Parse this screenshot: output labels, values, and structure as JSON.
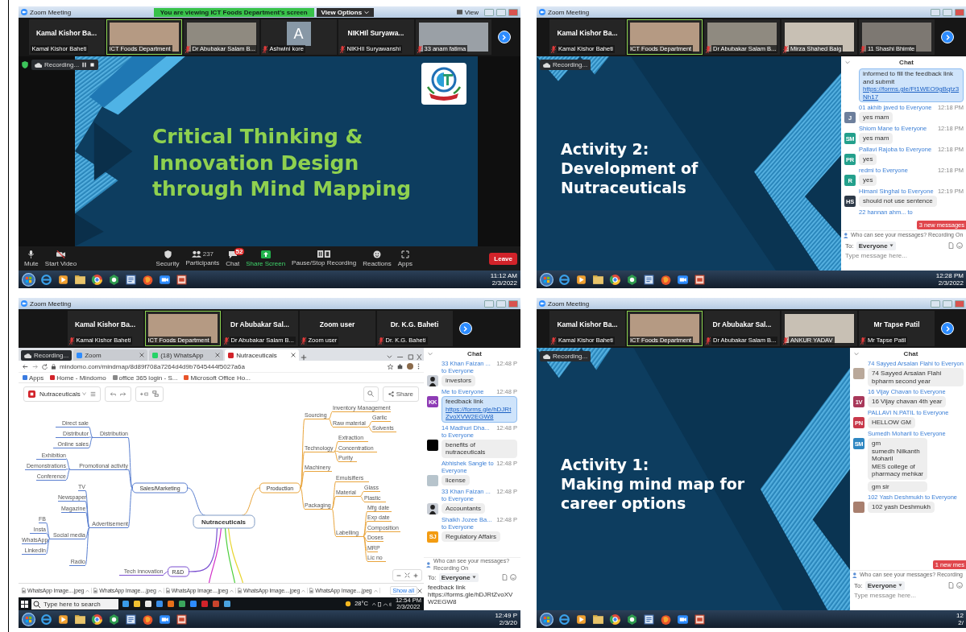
{
  "panels": [
    {
      "kind": "slide-share",
      "title": "Zoom Meeting",
      "banner": "You are viewing ICT Foods Department's screen",
      "view_options": "View Options",
      "view_label": "View",
      "participants": [
        {
          "kind": "name",
          "name": "Kamal Kishor Ba...",
          "label": "Kamal Kishor Baheti",
          "muted": false,
          "speaking": false
        },
        {
          "kind": "video",
          "label": "ICT Foods Department",
          "muted": false,
          "speaking": true
        },
        {
          "kind": "video",
          "label": "Dr Abubakar Salam B...",
          "muted": true,
          "speaking": false
        },
        {
          "kind": "letter",
          "letter": "A",
          "label": "Ashwini kore",
          "muted": true,
          "speaking": false
        },
        {
          "kind": "name",
          "name": "NIKHIl Suryawa...",
          "label": "NIKHIl Suryawanshi",
          "muted": true,
          "speaking": false
        },
        {
          "kind": "video",
          "label": "33 anam fatima",
          "muted": true,
          "speaking": false
        }
      ],
      "recording": "Recording...",
      "slide": {
        "kind": "green-title",
        "logo": true,
        "lines": [
          "Critical Thinking &",
          "Innovation Design",
          "through Mind Mapping"
        ]
      },
      "toolbar": [
        {
          "kind": "mic",
          "label": "Mute"
        },
        {
          "kind": "video",
          "label": "Start Video"
        },
        {
          "kind": "shield",
          "label": "Security"
        },
        {
          "kind": "people",
          "label": "Participants",
          "count": "237"
        },
        {
          "kind": "chat",
          "label": "Chat",
          "badge": "52"
        },
        {
          "kind": "share",
          "label": "Share Screen"
        },
        {
          "kind": "record",
          "label": "Pause/Stop Recording"
        },
        {
          "kind": "reactions",
          "label": "Reactions"
        },
        {
          "kind": "apps",
          "label": "Apps"
        }
      ],
      "leave": "Leave",
      "clock": {
        "time": "11:12 AM",
        "date": "2/3/2022"
      }
    },
    {
      "kind": "slide-chat",
      "title": "Zoom Meeting",
      "participants": [
        {
          "kind": "name",
          "name": "Kamal Kishor Ba...",
          "label": "Kamal Kishor Baheti",
          "muted": true,
          "speaking": false
        },
        {
          "kind": "video",
          "label": "ICT Foods Department",
          "muted": false,
          "speaking": true
        },
        {
          "kind": "video",
          "label": "Dr Abubakar Salam B...",
          "muted": true,
          "speaking": false
        },
        {
          "kind": "video",
          "label": "Mirza Shahed Baig",
          "muted": true,
          "speaking": false
        },
        {
          "kind": "video",
          "label": "11 Shashi Bhimte",
          "muted": true,
          "speaking": false
        }
      ],
      "recording": "Recording...",
      "slide": {
        "kind": "white-title",
        "lines": [
          "Activity 2:",
          "Development of",
          "Nutraceuticals"
        ]
      },
      "chat": {
        "title": "Chat",
        "messages": [
          {
            "own": true,
            "bubbles": [
              {
                "text": "informed to fill the feedback link and submit",
                "link": "https://forms.gle/Ft1WEO9gBqtz3Nh17"
              }
            ]
          },
          {
            "own": false,
            "header": "01 akhib javed to Everyone",
            "time": "12:18 PM",
            "avatar": {
              "kind": "initials",
              "text": "J",
              "color": "#6d7f9c"
            },
            "bubbles": [
              {
                "text": "yes mam"
              }
            ]
          },
          {
            "own": false,
            "header": "Shiom Mane to Everyone",
            "time": "12:18 PM",
            "avatar": {
              "kind": "initials",
              "text": "SM",
              "color": "#23a08c"
            },
            "bubbles": [
              {
                "text": "yes mam"
              }
            ]
          },
          {
            "own": false,
            "header": "Pallavi Rajoba to Everyone",
            "time": "12:18 PM",
            "avatar": {
              "kind": "initials",
              "text": "PR",
              "color": "#23a08c"
            },
            "bubbles": [
              {
                "text": "yes"
              }
            ]
          },
          {
            "own": false,
            "header": "redmi to Everyone",
            "time": "12:18 PM",
            "avatar": {
              "kind": "initials",
              "text": "R",
              "color": "#23a08c"
            },
            "bubbles": [
              {
                "text": "yes"
              }
            ]
          },
          {
            "own": false,
            "header": "Himani Singhal to Everyone",
            "time": "12:19 PM",
            "avatar": {
              "kind": "initials",
              "text": "HS",
              "color": "#2e3a48"
            },
            "bubbles": [
              {
                "text": "should not use sentence"
              }
            ]
          },
          {
            "header": "22 hannan ahm... to"
          }
        ],
        "new_messages": "3 new messages",
        "privacy": "Who can see your messages? Recording On",
        "to_label": "To:",
        "recipient": "Everyone",
        "placeholder": "Type message here..."
      },
      "clock": {
        "time": "12:28 PM",
        "date": "2/3/2022"
      }
    },
    {
      "kind": "browser-chat",
      "title": "Zoom Meeting",
      "participants": [
        {
          "kind": "name",
          "name": "Kamal Kishor Ba...",
          "label": "Kamal Kishor Baheti",
          "muted": true,
          "speaking": false
        },
        {
          "kind": "video",
          "label": "ICT Foods Department",
          "muted": false,
          "speaking": true
        },
        {
          "kind": "name",
          "name": "Dr Abubakar Sal...",
          "label": "Dr Abubakar Salam B...",
          "muted": true,
          "speaking": false
        },
        {
          "kind": "name",
          "name": "Zoom user",
          "label": "Zoom user",
          "muted": true,
          "speaking": false
        },
        {
          "kind": "name",
          "name": "Dr. K.G. Baheti",
          "label": "Dr. K.G. Baheti",
          "muted": true,
          "speaking": false
        }
      ],
      "recording": "Recording...",
      "browser": {
        "tabs": [
          {
            "title": "Zoom",
            "selected": false
          },
          {
            "title": "(18) WhatsApp",
            "selected": false
          },
          {
            "title": "Nutraceuticals",
            "selected": true
          }
        ],
        "url": "mindomo.com/mindmap/8d89f708a7264d4d9b7645444f5027a6a",
        "bookmarks": [
          "Apps",
          "Home - Mindomo",
          "office 365 login - S...",
          "Microsoft Office Ho..."
        ],
        "map_name": "Nutraceuticals",
        "share": "Share",
        "mindmap": {
          "text": "Nutraceuticals",
          "children": [
            {
              "text": "Sales/Marketing",
              "children": [
                {
                  "text": "Distribution",
                  "children": [
                    {
                      "text": "Direct sale"
                    },
                    {
                      "text": "Distributor"
                    },
                    {
                      "text": "Online sales"
                    }
                  ]
                },
                {
                  "text": "Promotional activity",
                  "children": [
                    {
                      "text": "Exhibition"
                    },
                    {
                      "text": "Demonstrations"
                    },
                    {
                      "text": "Conference"
                    }
                  ]
                },
                {
                  "text": "Advertisement",
                  "children": [
                    {
                      "text": "TV"
                    },
                    {
                      "text": "Newspaper"
                    },
                    {
                      "text": "Magazine"
                    },
                    {
                      "text": "Social media",
                      "children": [
                        {
                          "text": "FB"
                        },
                        {
                          "text": "Insta"
                        },
                        {
                          "text": "WhatsApp"
                        },
                        {
                          "text": "LinkedIn"
                        }
                      ]
                    },
                    {
                      "text": "Radio"
                    }
                  ]
                }
              ]
            },
            {
              "text": "Production",
              "children": [
                {
                  "text": "Sourcing",
                  "children": [
                    {
                      "text": "Inventory Management"
                    },
                    {
                      "text": "Raw material",
                      "children": [
                        {
                          "text": "Garlic"
                        },
                        {
                          "text": "Solvents"
                        }
                      ]
                    }
                  ]
                },
                {
                  "text": "Technology",
                  "children": [
                    {
                      "text": "Extraction"
                    },
                    {
                      "text": "Concentration"
                    },
                    {
                      "text": "Purity"
                    }
                  ]
                },
                {
                  "text": "Machinery"
                },
                {
                  "text": "Packaging",
                  "children": [
                    {
                      "text": "Emulsifiers"
                    },
                    {
                      "text": "Material",
                      "children": [
                        {
                          "text": "Glass"
                        },
                        {
                          "text": "Plastic"
                        }
                      ]
                    },
                    {
                      "text": "Labelling",
                      "children": [
                        {
                          "text": "Mfg date"
                        },
                        {
                          "text": "Exp date"
                        },
                        {
                          "text": "Composition"
                        },
                        {
                          "text": "Doses"
                        },
                        {
                          "text": "MRP"
                        },
                        {
                          "text": "Lic no"
                        }
                      ]
                    }
                  ]
                }
              ]
            },
            {
              "text": "R&D",
              "children": [
                {
                  "text": "Tech innovation"
                }
              ]
            }
          ]
        },
        "downloads": [
          "WhatsApp Image....jpeg",
          "WhatsApp Image....jpeg",
          "WhatsApp Image....jpeg",
          "WhatsApp Image....jpeg",
          "WhatsApp Image....jpeg"
        ],
        "show_all": "Show all",
        "search_placeholder": "Type here to search",
        "weather": "28°C",
        "clock": {
          "time": "12:54 PM",
          "date": "2/3/2022"
        }
      },
      "chat": {
        "title": "Chat",
        "messages": [
          {
            "own": false,
            "header": "33 Khan Faizan ... to Everyone",
            "time": "12:48 P",
            "avatar": {
              "kind": "silhouette",
              "color": "#c9ced6"
            },
            "bubbles": [
              {
                "text": "investors"
              }
            ]
          },
          {
            "own": true,
            "header": "Me to Everyone",
            "time": "12:48 P",
            "avatar": {
              "kind": "initials",
              "text": "KK",
              "color": "#8e3bb5"
            },
            "bubbles": [
              {
                "text": "feedback link",
                "link": "https://forms.gle/hDJRtZvoXVW2EGW8"
              }
            ]
          },
          {
            "own": false,
            "header": "14 Madhuri Dha... to Everyone",
            "time": "12:48 P",
            "avatar": {
              "kind": "initials",
              "color": "#000000"
            },
            "bubbles": [
              {
                "text": "benefits of nutraceuticals"
              }
            ]
          },
          {
            "own": false,
            "header": "Abhishek Sangle to Everyone",
            "time": "12:48 P",
            "avatar": {
              "kind": "photo",
              "color": "#b7c4cc"
            },
            "bubbles": [
              {
                "text": "license"
              }
            ]
          },
          {
            "own": false,
            "header": "33 Khan Faizan ... to Everyone",
            "time": "12:48 P",
            "avatar": {
              "kind": "silhouette",
              "color": "#c9ced6"
            },
            "bubbles": [
              {
                "text": "Accountants"
              }
            ]
          },
          {
            "own": false,
            "header": "Shaikh Jozee Ba... to Everyone",
            "time": "12:48 P",
            "avatar": {
              "kind": "initials",
              "text": "SJ",
              "color": "#f39c12"
            },
            "bubbles": [
              {
                "text": "Regulatory Affairs"
              }
            ]
          }
        ],
        "privacy": "Who can see your messages? Recording On",
        "to_label": "To:",
        "recipient": "Everyone",
        "value": "feedback link https://forms.gle/hDJRtZvoXVW2EGW8"
      },
      "clock": {
        "time": "12:49 P",
        "date": "2/3/20"
      }
    },
    {
      "kind": "slide-chat",
      "title": "Zoom Meeting",
      "participants": [
        {
          "kind": "name",
          "name": "Kamal Kishor Ba...",
          "label": "Kamal Kishor Baheti",
          "muted": true,
          "speaking": false
        },
        {
          "kind": "video",
          "label": "ICT Foods Department",
          "muted": false,
          "speaking": true
        },
        {
          "kind": "name",
          "name": "Dr Abubakar Sal...",
          "label": "Dr Abubakar Salam B...",
          "muted": true,
          "speaking": false
        },
        {
          "kind": "video",
          "label": "ANKUR YADAV",
          "muted": true,
          "speaking": false
        },
        {
          "kind": "name",
          "name": "Mr Tapse Patil",
          "label": "Mr Tapse Patil",
          "muted": true,
          "speaking": false
        }
      ],
      "recording": "Recording...",
      "slide": {
        "kind": "white-title",
        "lines": [
          "Activity 1:",
          "Making mind map for",
          "career options"
        ]
      },
      "chat": {
        "title": "Chat",
        "messages": [
          {
            "own": false,
            "header": "74 Sayyed Arsalan Flahi to Everyon",
            "avatar": {
              "kind": "photo",
              "color": "#b9a89a"
            },
            "bubbles": [
              {
                "text": "74 Sayyed Arsalan Flahi bpharm second year"
              }
            ]
          },
          {
            "own": false,
            "header": "16 Vijay Chavan to Everyone",
            "avatar": {
              "kind": "initials",
              "text": "1V",
              "color": "#a8385a"
            },
            "bubbles": [
              {
                "text": "16 Vijay chavan 4th year"
              }
            ]
          },
          {
            "own": false,
            "header": "PALLAVI N.PATIL to Everyone",
            "avatar": {
              "kind": "initials",
              "text": "PN",
              "color": "#c8384a"
            },
            "bubbles": [
              {
                "text": "HELLOW GM"
              }
            ]
          },
          {
            "own": false,
            "header": "Sumedh Moharil to Everyone",
            "avatar": {
              "kind": "initials",
              "text": "SM",
              "color": "#2e86c1"
            },
            "bubbles": [
              {
                "text": "gm\nsumedh Nilkanth\nMoharil\nMES college of\npharmacy mehkar"
              },
              {
                "text": "gm sir"
              }
            ]
          },
          {
            "own": false,
            "header": "102 Yash Deshmukh to Everyone",
            "avatar": {
              "kind": "photo",
              "color": "#a87f6e"
            },
            "bubbles": [
              {
                "text": "102 yash Deshmukh"
              }
            ]
          }
        ],
        "new_messages": "1 new mes",
        "privacy": "Who can see your messages? Recording",
        "to_label": "To:",
        "recipient": "Everyone",
        "placeholder": "Type message here..."
      },
      "clock": {
        "time": "12",
        "date": "2/"
      }
    }
  ]
}
